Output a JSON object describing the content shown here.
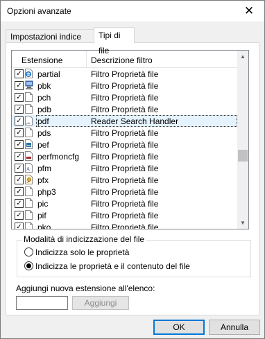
{
  "dialog": {
    "title": "Opzioni avanzate",
    "close_glyph": "✕"
  },
  "tabs": [
    {
      "label": "Impostazioni indice",
      "active": false
    },
    {
      "label": "Tipi di file",
      "active": true
    }
  ],
  "list": {
    "columns": [
      "Estensione",
      "Descrizione filtro"
    ],
    "rows": [
      {
        "ext": "partial",
        "desc": "Filtro Proprietà file",
        "checked": true,
        "icon": "ie-document-icon"
      },
      {
        "ext": "pbk",
        "desc": "Filtro Proprietà file",
        "checked": true,
        "icon": "phonebook-icon"
      },
      {
        "ext": "pch",
        "desc": "Filtro Proprietà file",
        "checked": true,
        "icon": "file-icon"
      },
      {
        "ext": "pdb",
        "desc": "Filtro Proprietà file",
        "checked": true,
        "icon": "file-icon"
      },
      {
        "ext": "pdf",
        "desc": "Reader Search Handler",
        "checked": true,
        "icon": "pdf-file-icon",
        "selected": true
      },
      {
        "ext": "pds",
        "desc": "Filtro Proprietà file",
        "checked": true,
        "icon": "file-icon"
      },
      {
        "ext": "pef",
        "desc": "Filtro Proprietà file",
        "checked": true,
        "icon": "image-file-icon"
      },
      {
        "ext": "perfmoncfg",
        "desc": "Filtro Proprietà file",
        "checked": true,
        "icon": "perfmon-icon"
      },
      {
        "ext": "pfm",
        "desc": "Filtro Proprietà file",
        "checked": true,
        "icon": "font-file-icon"
      },
      {
        "ext": "pfx",
        "desc": "Filtro Proprietà file",
        "checked": true,
        "icon": "certificate-icon"
      },
      {
        "ext": "php3",
        "desc": "Filtro Proprietà file",
        "checked": true,
        "icon": "file-icon"
      },
      {
        "ext": "pic",
        "desc": "Filtro Proprietà file",
        "checked": true,
        "icon": "file-icon"
      },
      {
        "ext": "pif",
        "desc": "Filtro Proprietà file",
        "checked": true,
        "icon": "file-icon"
      },
      {
        "ext": "pko",
        "desc": "Filtro Proprietà file",
        "checked": true,
        "icon": "file-icon"
      }
    ],
    "scroll_up_glyph": "▲",
    "scroll_down_glyph": "▼"
  },
  "indexing_mode": {
    "title": "Modalità di indicizzazione del file",
    "options": [
      {
        "label": "Indicizza solo le proprietà",
        "selected": false
      },
      {
        "label": "Indicizza le proprietà e il contenuto del file",
        "selected": true
      }
    ]
  },
  "add_extension": {
    "label": "Aggiungi nuova estensione all'elenco:",
    "value": "",
    "button": "Aggiungi"
  },
  "buttons": {
    "ok": "OK",
    "cancel": "Annulla"
  },
  "colors": {
    "selection": "#e5f3ff",
    "default_button_border": "#0078d7"
  }
}
